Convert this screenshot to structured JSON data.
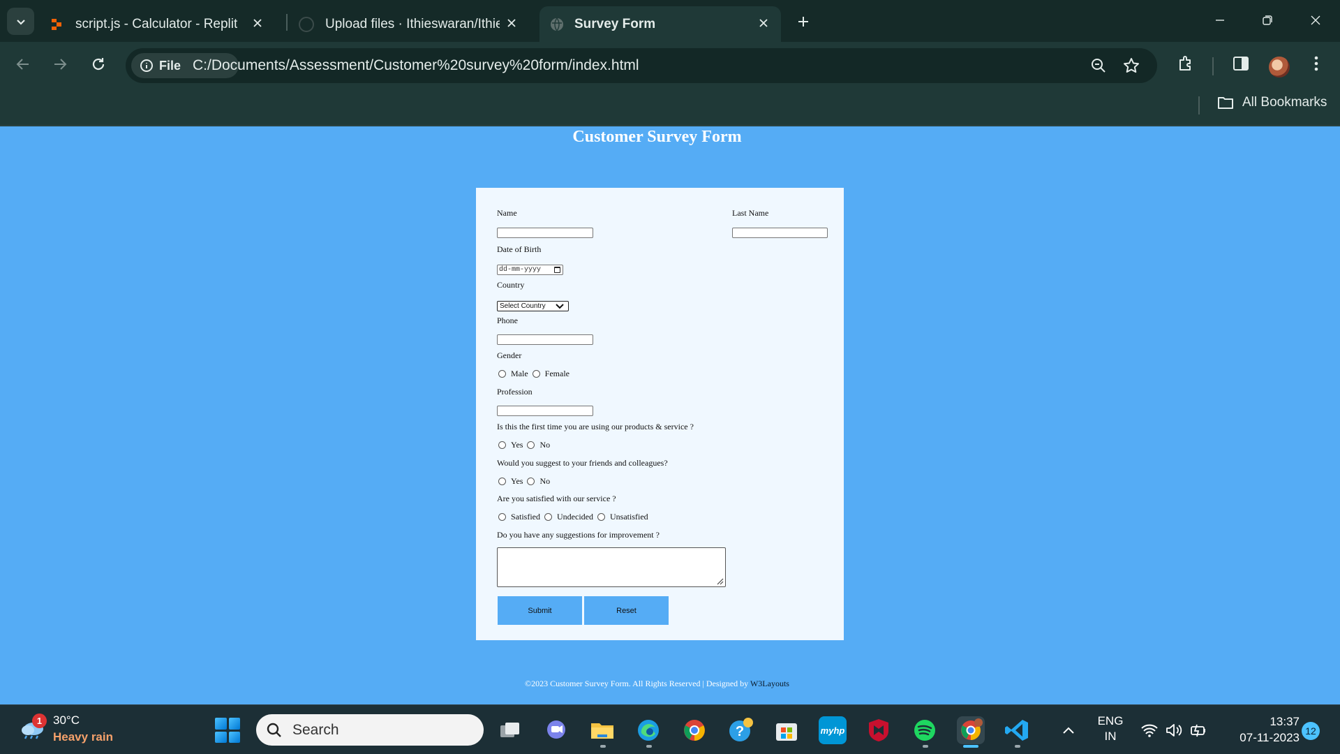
{
  "browser": {
    "tabs": [
      {
        "title": "script.js - Calculator - Replit",
        "favicon": "replit-icon"
      },
      {
        "title": "Upload files · Ithieswaran/Ithie",
        "favicon": "github-icon"
      },
      {
        "title": "Survey Form",
        "favicon": "globe-icon",
        "active": true
      }
    ],
    "site_chip_label": "File",
    "url": "C:/Documents/Assessment/Customer%20survey%20form/index.html",
    "bookmarks_label": "All Bookmarks",
    "accent_color": "#1f3937"
  },
  "page": {
    "title": "Customer Survey Form",
    "background_color": "#55acf5",
    "form": {
      "name_label": "Name",
      "last_name_label": "Last Name",
      "dob_label": "Date of Birth",
      "dob_placeholder": "dd-mm-yyyy",
      "country_label": "Country",
      "country_selected": "Select Country",
      "phone_label": "Phone",
      "gender_label": "Gender",
      "gender_options": [
        "Male",
        "Female"
      ],
      "profession_label": "Profession",
      "q_first_time": "Is this the first time you are using our products & service ?",
      "q_first_time_options": [
        "Yes",
        "No"
      ],
      "q_suggest": "Would you suggest to your friends and colleagues?",
      "q_suggest_options": [
        "Yes",
        "No"
      ],
      "q_satisfied": "Are you satisfied with our service ?",
      "q_satisfied_options": [
        "Satisfied",
        "Undecided",
        "Unsatisfied"
      ],
      "q_improve": "Do you have any suggestions for improvement ?",
      "submit_label": "Submit",
      "reset_label": "Reset"
    },
    "footer_text": "©2023 Customer Survey Form. All Rights Reserved | Designed by",
    "footer_link": "W3Layouts"
  },
  "taskbar": {
    "weather_temp": "30°C",
    "weather_desc": "Heavy rain",
    "weather_badge": "1",
    "search_label": "Search",
    "lang_line1": "ENG",
    "lang_line2": "IN",
    "time": "13:37",
    "date": "07-11-2023",
    "notification_count": "12"
  }
}
